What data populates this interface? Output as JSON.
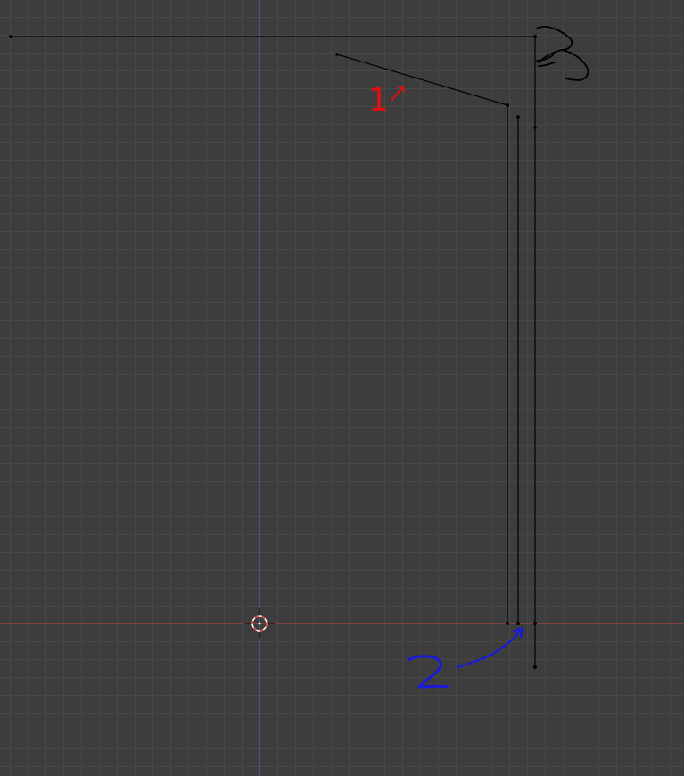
{
  "viewport": {
    "background_color": "#3d3d3d",
    "grid_color": "#484848",
    "axis_x_color": "#a83b3b",
    "axis_y_color": "#3f6fa8",
    "edge_color": "#000000",
    "cursor_icon": "3d-cursor-icon"
  },
  "annotations": {
    "label_1": "1",
    "label_2": "2",
    "label_1_color": "#e01010",
    "label_2_color": "#1a1ad8",
    "scribble_color": "#000000"
  }
}
